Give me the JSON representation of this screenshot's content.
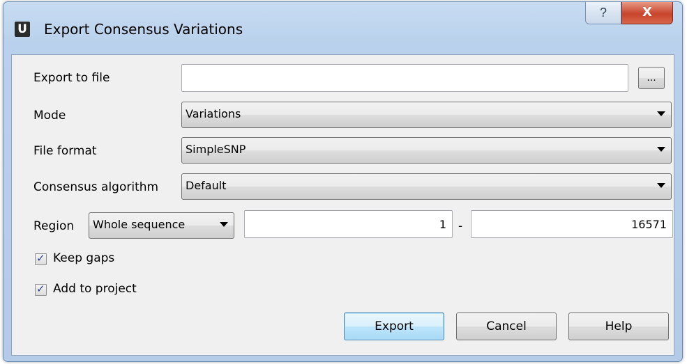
{
  "window": {
    "title": "Export Consensus Variations",
    "app_icon_letter": "U",
    "help_glyph": "?",
    "close_glyph": "X"
  },
  "form": {
    "export_to_file": {
      "label": "Export to file",
      "value": "",
      "browse_label": "..."
    },
    "mode": {
      "label": "Mode",
      "selected": "Variations"
    },
    "file_format": {
      "label": "File format",
      "selected": "SimpleSNP"
    },
    "consensus_algorithm": {
      "label": "Consensus algorithm",
      "selected": "Default"
    },
    "region": {
      "label": "Region",
      "selected": "Whole sequence",
      "start": "1",
      "separator": "-",
      "end": "16571"
    },
    "keep_gaps": {
      "label": "Keep gaps",
      "checked": true
    },
    "add_to_project": {
      "label": "Add to project",
      "checked": true
    }
  },
  "buttons": {
    "export": "Export",
    "cancel": "Cancel",
    "help": "Help"
  },
  "colors": {
    "title_bar": "#b9d1ec",
    "client_background": "#f0f0f0",
    "close_button": "#c7442b",
    "default_button": "#bee6fd"
  }
}
